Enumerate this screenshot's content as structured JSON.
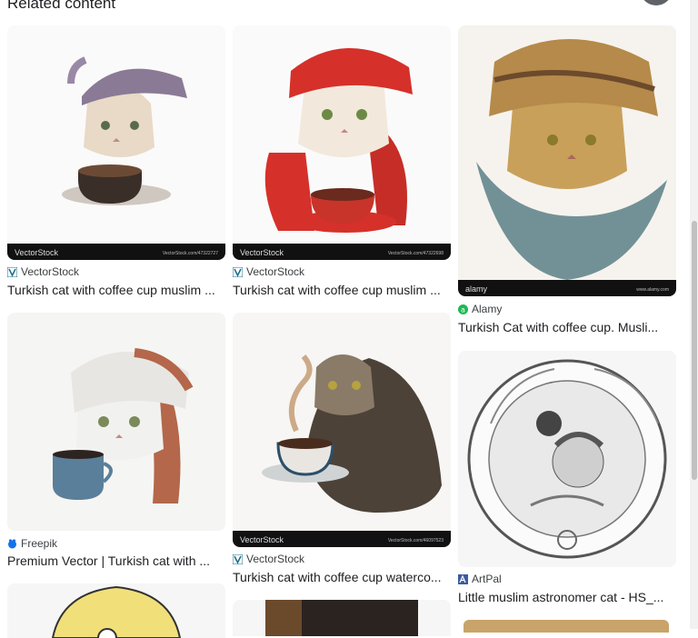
{
  "section_heading": "Related content",
  "cards": [
    {
      "source": "VectorStock",
      "title": "Turkish cat with coffee cup muslim ...",
      "favicon": "vectorstock-icon",
      "watermark": "VectorStock",
      "watermark_url": "VectorStock.com/47322727"
    },
    {
      "source": "VectorStock",
      "title": "Turkish cat with coffee cup muslim ...",
      "favicon": "vectorstock-icon",
      "watermark": "VectorStock",
      "watermark_url": "VectorStock.com/47322698"
    },
    {
      "source": "Alamy",
      "title": "Turkish Cat with coffee cup. Musli...",
      "favicon": "alamy-icon",
      "watermark": "alamy",
      "watermark_url": "www.alamy.com"
    },
    {
      "source": "Freepik",
      "title": "Premium Vector | Turkish cat with ...",
      "favicon": "freepik-icon"
    },
    {
      "source": "VectorStock",
      "title": "Turkish cat with coffee cup waterco...",
      "favicon": "vectorstock-icon",
      "watermark": "VectorStock",
      "watermark_url": "VectorStock.com/46097523"
    },
    {
      "source": "ArtPal",
      "title": "Little muslim astronomer cat - HS_...",
      "favicon": "artpal-icon"
    }
  ],
  "colors": {
    "accent_red": "#d6302a",
    "alamy_green": "#1db954",
    "freepik_blue": "#1273eb"
  }
}
